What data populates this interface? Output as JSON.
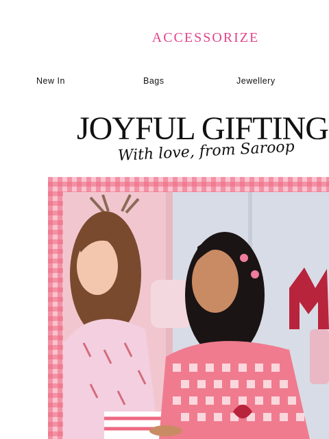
{
  "brand": {
    "name": "ACCESSORIZE",
    "color": "#e2438a"
  },
  "nav": {
    "items": [
      {
        "label": "New In"
      },
      {
        "label": "Bags"
      },
      {
        "label": "Jewellery"
      }
    ]
  },
  "hero": {
    "headline": "JOYFUL GIFTING",
    "subline": "With love, from Saroop",
    "frame_pattern": "pink-gingham",
    "image": "two-women-in-pink-pyjamas-photo"
  }
}
